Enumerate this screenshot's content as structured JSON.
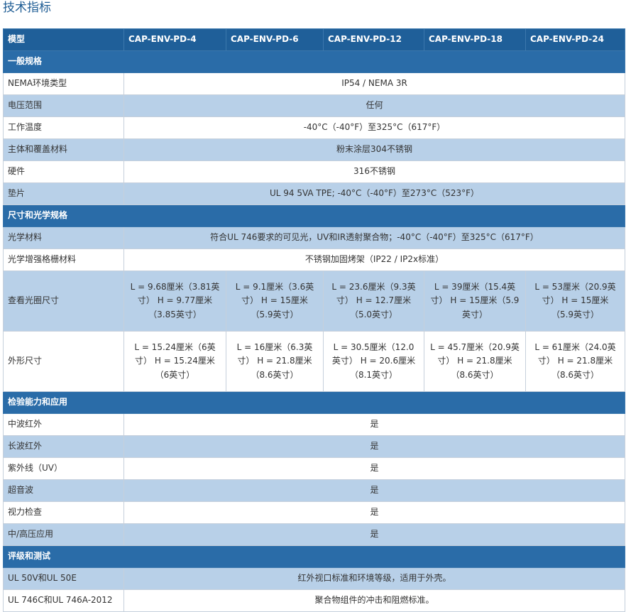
{
  "title": "技术指标",
  "header": {
    "label": "模型",
    "models": [
      "CAP-ENV-PD-4",
      "CAP-ENV-PD-6",
      "CAP-ENV-PD-12",
      "CAP-ENV-PD-18",
      "CAP-ENV-PD-24"
    ]
  },
  "sections": {
    "general": "一般规格",
    "optical": "尺寸和光学规格",
    "inspection": "检验能力和应用",
    "ratings": "评级和测试"
  },
  "general": {
    "nema": {
      "label": "NEMA环境类型",
      "value": "IP54 / NEMA 3R"
    },
    "voltage": {
      "label": "电压范围",
      "value": "任何"
    },
    "temp": {
      "label": "工作温度",
      "value": "-40°C（-40°F）至325°C（617°F）"
    },
    "body": {
      "label": "主体和覆盖材料",
      "value": "粉末涂层304不锈钢"
    },
    "hardware": {
      "label": "硬件",
      "value": "316不锈钢"
    },
    "gasket": {
      "label": "垫片",
      "value": "UL 94 5VA TPE; -40°C（-40°F）至273°C（523°F）"
    }
  },
  "optical": {
    "material": {
      "label": "光学材料",
      "value": "符合UL 746要求的可见光，UV和IR透射聚合物；-40°C（-40°F）至325°C（617°F）"
    },
    "grille": {
      "label": "光学增强格栅材料",
      "value": "不锈钢加固烤架（IP22 / IP2x标准）"
    },
    "aperture": {
      "label": "查看光圈尺寸",
      "values": [
        "L = 9.68厘米（3.81英寸） H = 9.77厘米（3.85英寸）",
        "L = 9.1厘米（3.6英寸） H = 15厘米（5.9英寸）",
        "L = 23.6厘米（9.3英寸） H = 12.7厘米（5.0英寸）",
        "L = 39厘米（15.4英寸） H = 15厘米（5.9英寸）",
        "L = 53厘米（20.9英寸） H = 15厘米（5.9英寸）"
      ]
    },
    "outer": {
      "label": "外形尺寸",
      "values": [
        "L = 15.24厘米（6英寸） H = 15.24厘米（6英寸）",
        "L = 16厘米（6.3英寸） H = 21.8厘米（8.6英寸）",
        "L = 30.5厘米（12.0英寸） H = 20.6厘米（8.1英寸）",
        "L = 45.7厘米（20.9英寸） H = 21.8厘米（8.6英寸）",
        "L = 61厘米（24.0英寸） H = 21.8厘米（8.6英寸）"
      ]
    }
  },
  "inspection": {
    "mwir": {
      "label": "中波红外",
      "value": "是"
    },
    "lwir": {
      "label": "长波红外",
      "value": "是"
    },
    "uv": {
      "label": "紫外线（UV）",
      "value": "是"
    },
    "ultrasound": {
      "label": "超音波",
      "value": "是"
    },
    "visual": {
      "label": "视力检查",
      "value": "是"
    },
    "hv": {
      "label": "中/高压应用",
      "value": "是"
    }
  },
  "ratings": {
    "ul50": {
      "label": "UL 50V和UL 50E",
      "value": "红外视口标准和环境等级，适用于外壳。"
    },
    "ul746": {
      "label": "UL 746C和UL 746A-2012",
      "value": "聚合物组件的冲击和阻燃标准。"
    }
  }
}
